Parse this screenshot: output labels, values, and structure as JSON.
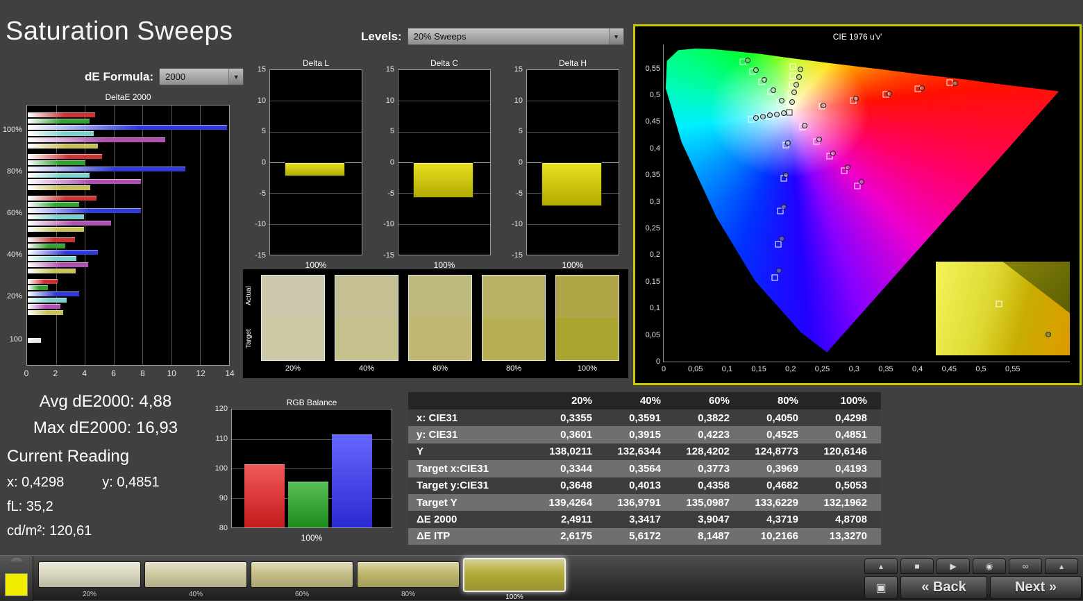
{
  "page": {
    "title": "Saturation Sweeps"
  },
  "controls": {
    "levels_label": "Levels:",
    "levels_value": "20% Sweeps",
    "de_formula_label": "dE Formula:",
    "de_formula_value": "2000"
  },
  "stats": {
    "avg": "Avg dE2000: 4,88",
    "max": "Max dE2000: 16,93"
  },
  "reading": {
    "title": "Current Reading",
    "x": "x: 0,4298",
    "y": "y: 0,4851",
    "fl": "fL: 35,2",
    "cdm2": "cd/m²: 120,61"
  },
  "chart_data": [
    {
      "id": "deltae2000",
      "type": "bar",
      "orientation": "horizontal",
      "title": "DeltaE 2000",
      "xlim": [
        0,
        14
      ],
      "xticks": [
        0,
        2,
        4,
        6,
        8,
        10,
        12,
        14
      ],
      "series_colors": {
        "red": "#cc3333",
        "green": "#33a033",
        "blue": "#2f3bd8",
        "cyan": "#7fd0d0",
        "magenta": "#b050b0",
        "yellow": "#c9c25a",
        "white": "#e8e8e8"
      },
      "groups": [
        {
          "label": "100%",
          "values": {
            "red": 4.7,
            "green": 4.3,
            "blue": 13.9,
            "cyan": 4.6,
            "magenta": 9.6,
            "yellow": 4.87
          }
        },
        {
          "label": "80%",
          "values": {
            "red": 5.2,
            "green": 4.0,
            "blue": 11.0,
            "cyan": 4.3,
            "magenta": 7.9,
            "yellow": 4.37
          }
        },
        {
          "label": "60%",
          "values": {
            "red": 4.8,
            "green": 3.6,
            "blue": 7.9,
            "cyan": 3.9,
            "magenta": 5.8,
            "yellow": 3.9
          }
        },
        {
          "label": "40%",
          "values": {
            "red": 3.3,
            "green": 2.6,
            "blue": 4.9,
            "cyan": 3.4,
            "magenta": 4.2,
            "yellow": 3.34
          }
        },
        {
          "label": "20%",
          "values": {
            "red": 2.1,
            "green": 1.4,
            "blue": 3.6,
            "cyan": 2.7,
            "magenta": 2.3,
            "yellow": 2.49
          }
        },
        {
          "label": "100",
          "values": {
            "white": 0.9
          }
        }
      ]
    },
    {
      "id": "delta_l",
      "type": "bar",
      "title": "Delta L",
      "ylim": [
        -15,
        15
      ],
      "yticks": [
        15,
        10,
        5,
        0,
        -5,
        -10,
        -15
      ],
      "x_label": "100%",
      "values": [
        -2.2
      ],
      "bar_color": "#d8d000"
    },
    {
      "id": "delta_c",
      "type": "bar",
      "title": "Delta C",
      "ylim": [
        -15,
        15
      ],
      "yticks": [
        15,
        10,
        5,
        0,
        -5,
        -10,
        -15
      ],
      "x_label": "100%",
      "values": [
        -5.7
      ],
      "bar_color": "#d8d000"
    },
    {
      "id": "delta_h",
      "type": "bar",
      "title": "Delta H",
      "ylim": [
        -15,
        15
      ],
      "yticks": [
        15,
        10,
        5,
        0,
        -5,
        -10,
        -15
      ],
      "x_label": "100%",
      "values": [
        -7.1
      ],
      "bar_color": "#d8d000"
    },
    {
      "id": "rgb_balance",
      "type": "bar",
      "title": "RGB Balance",
      "ylim": [
        80,
        120
      ],
      "yticks": [
        120,
        110,
        100,
        90,
        80
      ],
      "x_label": "100%",
      "categories": [
        "Red",
        "Green",
        "Blue"
      ],
      "values": [
        101.5,
        95.5,
        111.5
      ],
      "colors": [
        "#ee2222",
        "#22aa22",
        "#3333ff"
      ]
    },
    {
      "id": "cie",
      "type": "scatter",
      "title": "CIE 1976 u'v'",
      "xlim": [
        0,
        0.64
      ],
      "ylim": [
        0,
        0.595
      ],
      "xtick_values": [
        0,
        0.05,
        0.1,
        0.15,
        0.2,
        0.25,
        0.3,
        0.35,
        0.4,
        0.45,
        0.5,
        0.55
      ],
      "xtick_labels": [
        "0",
        "0,05",
        "0,1",
        "0,15",
        "0,2",
        "0,25",
        "0,3",
        "0,35",
        "0,4",
        "0,45",
        "0,5",
        "0,55"
      ],
      "ytick_values": [
        0.55,
        0.5,
        0.45,
        0.4,
        0.35,
        0.3,
        0.25,
        0.2,
        0.15,
        0.1,
        0.05,
        0
      ],
      "ytick_labels": [
        "0,55",
        "0,5",
        "0,45",
        "0,4",
        "0,35",
        "0,3",
        "0,25",
        "0,2",
        "0,15",
        "0,1",
        "0,05",
        "0"
      ],
      "white_point": [
        0.198,
        0.468
      ],
      "targets": [
        [
          0.249,
          0.479
        ],
        [
          0.299,
          0.49
        ],
        [
          0.35,
          0.501
        ],
        [
          0.4,
          0.512
        ],
        [
          0.451,
          0.523
        ],
        [
          0.183,
          0.487
        ],
        [
          0.169,
          0.506
        ],
        [
          0.154,
          0.525
        ],
        [
          0.14,
          0.544
        ],
        [
          0.125,
          0.563
        ],
        [
          0.193,
          0.406
        ],
        [
          0.189,
          0.344
        ],
        [
          0.184,
          0.282
        ],
        [
          0.18,
          0.22
        ],
        [
          0.175,
          0.158
        ],
        [
          0.186,
          0.465
        ],
        [
          0.174,
          0.463
        ],
        [
          0.162,
          0.46
        ],
        [
          0.15,
          0.458
        ],
        [
          0.138,
          0.455
        ],
        [
          0.219,
          0.44
        ],
        [
          0.241,
          0.413
        ],
        [
          0.262,
          0.385
        ],
        [
          0.284,
          0.358
        ],
        [
          0.305,
          0.33
        ],
        [
          0.199,
          0.485
        ],
        [
          0.2,
          0.502
        ],
        [
          0.202,
          0.519
        ],
        [
          0.203,
          0.536
        ],
        [
          0.204,
          0.553
        ]
      ],
      "measurements": [
        [
          0.252,
          0.481
        ],
        [
          0.303,
          0.493
        ],
        [
          0.356,
          0.503
        ],
        [
          0.407,
          0.513
        ],
        [
          0.459,
          0.522
        ],
        [
          0.186,
          0.489
        ],
        [
          0.173,
          0.509
        ],
        [
          0.159,
          0.528
        ],
        [
          0.146,
          0.547
        ],
        [
          0.132,
          0.565
        ],
        [
          0.196,
          0.41
        ],
        [
          0.193,
          0.35
        ],
        [
          0.189,
          0.29
        ],
        [
          0.186,
          0.23
        ],
        [
          0.182,
          0.17
        ],
        [
          0.189,
          0.466
        ],
        [
          0.178,
          0.464
        ],
        [
          0.167,
          0.462
        ],
        [
          0.156,
          0.46
        ],
        [
          0.145,
          0.457
        ],
        [
          0.222,
          0.443
        ],
        [
          0.245,
          0.417
        ],
        [
          0.267,
          0.39
        ],
        [
          0.29,
          0.364
        ],
        [
          0.312,
          0.337
        ],
        [
          0.202,
          0.487
        ],
        [
          0.206,
          0.505
        ],
        [
          0.209,
          0.52
        ],
        [
          0.213,
          0.534
        ],
        [
          0.216,
          0.548
        ]
      ]
    }
  ],
  "swatches": {
    "actual_label": "Actual",
    "target_label": "Target",
    "items": [
      {
        "label": "20%",
        "actual": "#cbc8ab",
        "target": "#cbc8a6"
      },
      {
        "label": "40%",
        "actual": "#c5c094",
        "target": "#c5c08c"
      },
      {
        "label": "60%",
        "actual": "#bfb87d",
        "target": "#beb872"
      },
      {
        "label": "80%",
        "actual": "#b8b062",
        "target": "#b6b052"
      },
      {
        "label": "100%",
        "actual": "#b0a647",
        "target": "#aaa52f"
      }
    ]
  },
  "table": {
    "headers": [
      "",
      "20%",
      "40%",
      "60%",
      "80%",
      "100%"
    ],
    "rows": [
      {
        "label": "x: CIE31",
        "values": [
          "0,3355",
          "0,3591",
          "0,3822",
          "0,4050",
          "0,4298"
        ]
      },
      {
        "label": "y: CIE31",
        "values": [
          "0,3601",
          "0,3915",
          "0,4223",
          "0,4525",
          "0,4851"
        ]
      },
      {
        "label": "Y",
        "values": [
          "138,0211",
          "132,6344",
          "128,4202",
          "124,8773",
          "120,6146"
        ]
      },
      {
        "label": "Target x:CIE31",
        "values": [
          "0,3344",
          "0,3564",
          "0,3773",
          "0,3969",
          "0,4193"
        ]
      },
      {
        "label": "Target y:CIE31",
        "values": [
          "0,3648",
          "0,4013",
          "0,4358",
          "0,4682",
          "0,5053"
        ]
      },
      {
        "label": "Target Y",
        "values": [
          "139,4264",
          "136,9791",
          "135,0987",
          "133,6229",
          "132,1962"
        ]
      },
      {
        "label": "ΔE 2000",
        "values": [
          "2,4911",
          "3,3417",
          "3,9047",
          "4,3719",
          "4,8708"
        ]
      },
      {
        "label": "ΔE ITP",
        "values": [
          "2,6175",
          "5,6172",
          "8,1487",
          "10,2166",
          "13,3270"
        ]
      }
    ]
  },
  "toolbar": {
    "active_swatch_color": "#f2ec00",
    "sweeps": [
      {
        "label": "20%",
        "color": "#dad7c0",
        "selected": false
      },
      {
        "label": "40%",
        "color": "#d0cba2",
        "selected": false
      },
      {
        "label": "60%",
        "color": "#c7c087",
        "selected": false
      },
      {
        "label": "80%",
        "color": "#beb76a",
        "selected": false
      },
      {
        "label": "100%",
        "color": "#b3ab36",
        "selected": true
      }
    ],
    "nav_icons": [
      {
        "name": "scroll-up-left-icon",
        "glyph": "▴"
      },
      {
        "name": "stop-icon",
        "glyph": "■"
      },
      {
        "name": "play-icon",
        "glyph": "▶"
      },
      {
        "name": "camera-icon",
        "glyph": "◉"
      },
      {
        "name": "loop-icon",
        "glyph": "∞"
      },
      {
        "name": "scroll-up-right-icon",
        "glyph": "▴"
      }
    ],
    "square_button_icon": "▣",
    "back_label": "« Back",
    "next_label": "Next »"
  }
}
